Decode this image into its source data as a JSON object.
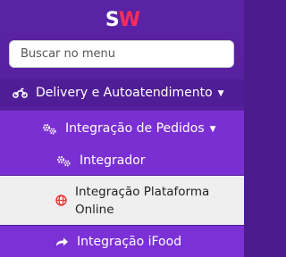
{
  "app": {
    "logo_text_s": "S",
    "logo_text_w": "W"
  },
  "search": {
    "placeholder": "Buscar no menu"
  },
  "menu": {
    "delivery": {
      "label": "Delivery e Autoatendimento",
      "icon": "motorcycle-icon"
    },
    "integracao_pedidos": {
      "label": "Integração de Pedidos",
      "icon": "gears-icon"
    },
    "integrador": {
      "label": "Integrador",
      "icon": "gears-icon"
    },
    "integracao_plataforma": {
      "label": "Integração Plataforma Online",
      "icon": "globe-icon",
      "active": true
    },
    "integracao_ifood": {
      "label": "Integração iFood",
      "icon": "share-arrow-icon"
    }
  },
  "colors": {
    "sidebar_bg": "#4f1d96",
    "submenu_bg": "#7a2fd2",
    "active_bg": "#efeff0",
    "accent_red": "#ff2d55"
  }
}
